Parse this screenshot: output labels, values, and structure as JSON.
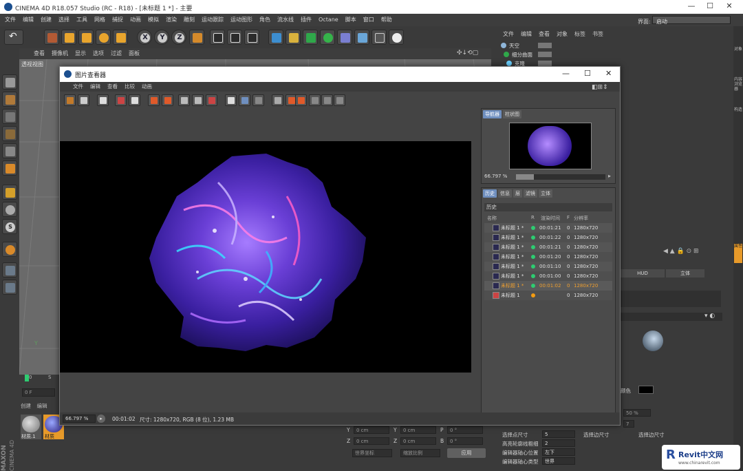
{
  "app": {
    "title": "CINEMA 4D R18.057 Studio (RC - R18) - [未标题 1 *] - 主要",
    "layout_label": "界面:",
    "layout_value": "启动",
    "menu": [
      "文件",
      "编辑",
      "创建",
      "选择",
      "工具",
      "网格",
      "捕捉",
      "动画",
      "模拟",
      "渲染",
      "雕刻",
      "运动跟踪",
      "运动图形",
      "角色",
      "流水线",
      "插件",
      "Octane",
      "脚本",
      "窗口",
      "帮助"
    ],
    "window_controls": [
      "—",
      "☐",
      "✕"
    ]
  },
  "viewport": {
    "menu": [
      "查看",
      "摄像机",
      "显示",
      "选项",
      "过滤",
      "面板"
    ],
    "name": "透视视图"
  },
  "object_manager": {
    "menu": [
      "文件",
      "编辑",
      "查看",
      "对象",
      "标签",
      "书签"
    ],
    "items": [
      "天空",
      "细分曲面",
      "克隆"
    ]
  },
  "right_tabs": [
    "对象",
    "内容浏览器",
    "构造"
  ],
  "right_tabs2": [
    "属性"
  ],
  "attributes": {
    "hud": "HUD",
    "stereo": "立体",
    "color_label": "颜色",
    "pct": "50 %",
    "seven": "7",
    "rows": [
      {
        "label": "选择点尺寸",
        "value": "5",
        "label2": "选择边尺寸"
      },
      {
        "label": "高亮轮廓线粗细",
        "value": "2"
      },
      {
        "label": "编辑器轴心位置",
        "value": "左下"
      },
      {
        "label": "编辑器轴心类型",
        "value": "世界"
      }
    ],
    "cut_rows": [
      "选择点尺寸",
      "选择边尺寸"
    ]
  },
  "timeline": {
    "frame_start": "0",
    "frame_label": "S",
    "frame_field": "0 F"
  },
  "materials": {
    "menu": [
      "创建",
      "编辑"
    ],
    "items": [
      "材质.1",
      "材质"
    ]
  },
  "coords": {
    "rows": [
      {
        "a": "Y",
        "av": "0 cm",
        "b": "Y",
        "bv": "0 cm",
        "c": "P",
        "cv": "0 °"
      },
      {
        "a": "Z",
        "av": "0 cm",
        "b": "Z",
        "bv": "0 cm",
        "c": "B",
        "cv": "0 °"
      }
    ],
    "mode1": "世界坐标",
    "mode2": "缩放比例",
    "apply": "应用"
  },
  "brand": {
    "line1": "MAXON",
    "line2": "CINEMA 4D"
  },
  "watermark": {
    "main": "Revit中文网",
    "url": "www.chinarevit.com"
  },
  "viewer": {
    "title": "图片查看器",
    "menu": [
      "文件",
      "编辑",
      "查看",
      "比较",
      "动画"
    ],
    "nav_tabs": [
      "导航器",
      "柱状图"
    ],
    "zoom": "66.797 %",
    "hist_tabs": [
      "历史",
      "信息",
      "层",
      "滤镜",
      "立体"
    ],
    "history_label": "历史",
    "columns": [
      "名称",
      "R",
      "渲染时间",
      "F",
      "分辨率"
    ],
    "rows": [
      {
        "name": "未标题 1 *",
        "status": "green",
        "time": "00:01:21",
        "f": "0",
        "res": "1280x720"
      },
      {
        "name": "未标题 1 *",
        "status": "green",
        "time": "00:01:22",
        "f": "0",
        "res": "1280x720"
      },
      {
        "name": "未标题 1 *",
        "status": "green",
        "time": "00:01:21",
        "f": "0",
        "res": "1280x720"
      },
      {
        "name": "未标题 1 *",
        "status": "green",
        "time": "00:01:20",
        "f": "0",
        "res": "1280x720"
      },
      {
        "name": "未标题 1 *",
        "status": "green",
        "time": "00:01:10",
        "f": "0",
        "res": "1280x720"
      },
      {
        "name": "未标题 1 *",
        "status": "green",
        "time": "00:01:00",
        "f": "0",
        "res": "1280x720"
      },
      {
        "name": "未标题 1 *",
        "status": "green",
        "time": "00:01:02",
        "f": "0",
        "res": "1280x720",
        "selected": true
      },
      {
        "name": "未标题 1",
        "status": "orange",
        "time": "",
        "f": "0",
        "res": "1280x720"
      }
    ],
    "status": {
      "zoom": "66.797 %",
      "time": "00:01:02",
      "info": "尺寸: 1280x720, RGB (8 位), 1.23 MB"
    }
  },
  "colors": {
    "accent": "#6f8fbf",
    "selected_row_text": "#f0a030",
    "status_green": "#2ecc71",
    "status_orange": "#f39c12"
  }
}
